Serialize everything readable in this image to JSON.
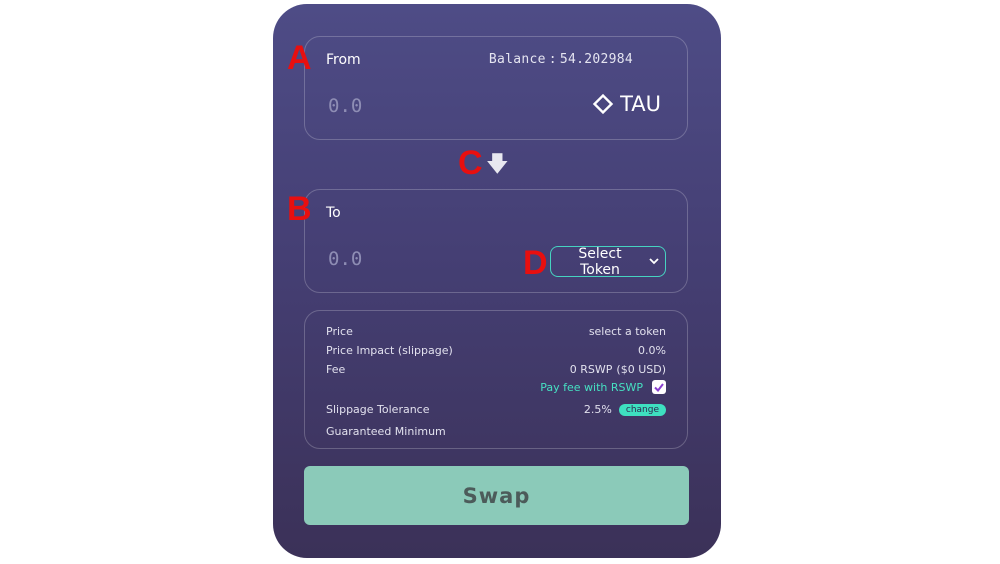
{
  "from": {
    "label": "From",
    "balance_label": "Balance",
    "balance_sep": ":",
    "balance_value": "54.202984",
    "amount_placeholder": "0.0",
    "token": "TAU",
    "token_icon": "diamond-icon"
  },
  "to": {
    "label": "To",
    "amount_placeholder": "0.0",
    "select_label": "Select Token",
    "select_icon": "chevron-down-icon"
  },
  "swap_direction_icon": "arrow-down-icon",
  "info": {
    "price_label": "Price",
    "price_value": "select a token",
    "impact_label": "Price Impact (slippage)",
    "impact_value": "0.0%",
    "fee_label": "Fee",
    "fee_value": "0 RSWP",
    "fee_usd": "($0 USD)",
    "pay_fee_label": "Pay fee with RSWP",
    "pay_fee_checked": true,
    "slippage_label": "Slippage Tolerance",
    "slippage_value": "2.5%",
    "change_label": "change",
    "guaranteed_label": "Guaranteed Minimum"
  },
  "swap_button": "Swap",
  "markers": {
    "a": "A",
    "b": "B",
    "c": "C",
    "d": "D"
  },
  "colors": {
    "accent": "#46d3c0",
    "swap_button": "#8bcab9",
    "marker": "#e80f0f",
    "card_top": "#4e4c86",
    "card_bottom": "#3b3158"
  }
}
